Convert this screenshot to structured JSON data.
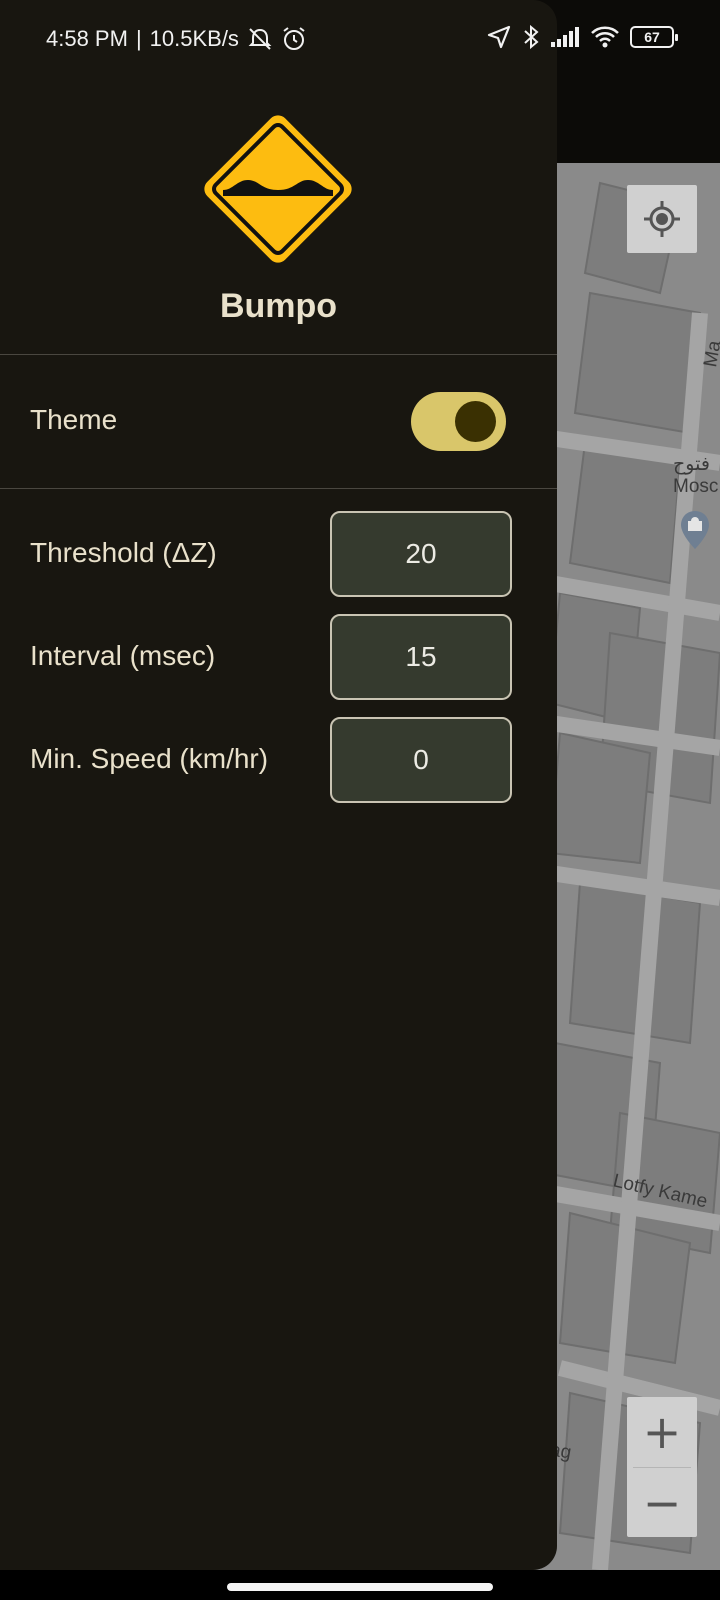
{
  "status_bar": {
    "time": "4:58 PM",
    "network_speed": "10.5KB/s",
    "battery_level": "67",
    "icons": [
      "muted-bell-icon",
      "alarm-icon",
      "location-arrow-icon",
      "bluetooth-icon",
      "signal-icon",
      "wifi-icon",
      "battery-icon"
    ]
  },
  "drawer": {
    "app_name": "Bumpo",
    "logo_icon": "bump-road-sign-icon",
    "theme": {
      "label": "Theme",
      "enabled": true
    },
    "settings": [
      {
        "label": "Threshold (ΔZ)",
        "value": "20"
      },
      {
        "label": "Interval (msec)",
        "value": "15"
      },
      {
        "label": "Min. Speed (km/hr)",
        "value": "0"
      }
    ]
  },
  "map": {
    "labels": [
      "Ma",
      "فتوح",
      "Mosc",
      "Lotfy Kame",
      "ag"
    ],
    "controls": {
      "locate_icon": "my-location-icon",
      "zoom_in": "+",
      "zoom_out": "−"
    }
  },
  "colors": {
    "drawer_bg": "#181610",
    "accent_yellow": "#fdbc10",
    "toggle_track": "#d9c66a",
    "field_bg": "#353a2e",
    "text_primary": "#e9e1cb"
  }
}
